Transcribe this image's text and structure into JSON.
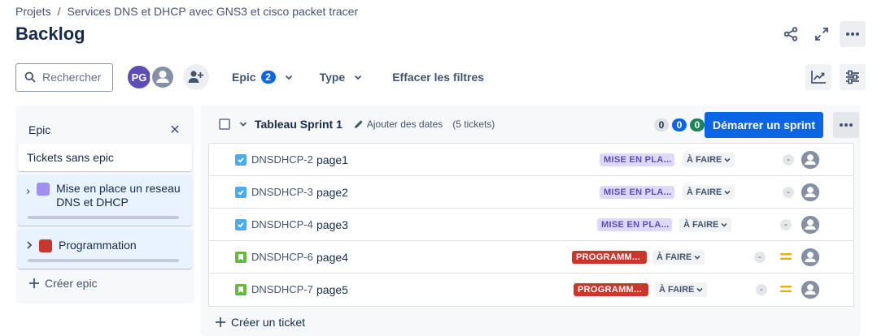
{
  "breadcrumb": {
    "root": "Projets",
    "separator": "/",
    "project": "Services DNS et DHCP avec GNS3 et cisco packet tracer"
  },
  "page": {
    "title": "Backlog"
  },
  "top_actions": [
    "share-icon",
    "expand-icon",
    "more-icon"
  ],
  "filters": {
    "search_placeholder": "Rechercher",
    "avatar_initials": "PG",
    "epic_label": "Epic",
    "epic_count": "2",
    "type_label": "Type",
    "clear_label": "Effacer les filtres"
  },
  "epic_panel": {
    "title": "Epic",
    "no_epic": "Tickets sans epic",
    "epics": [
      {
        "name": "Mise en place un reseau DNS et DHCP",
        "color": "#9f8fef"
      },
      {
        "name": "Programmation",
        "color": "#c9372c"
      }
    ],
    "create_label": "Créer epic"
  },
  "sprint": {
    "title": "Tableau Sprint 1",
    "add_dates": "Ajouter des dates",
    "ticket_count": "(5 tickets)",
    "count_todo": "0",
    "count_inprogress": "0",
    "count_done": "0",
    "start_label": "Démarrer un sprint",
    "tickets": [
      {
        "key": "DNSDHCP-2",
        "summary": "page1",
        "type": "task",
        "epic": "MISE EN PLA...",
        "status": "À FAIRE",
        "estimate": "-"
      },
      {
        "key": "DNSDHCP-3",
        "summary": "page2",
        "type": "task",
        "epic": "MISE EN PLA...",
        "status": "À FAIRE",
        "estimate": "-"
      },
      {
        "key": "DNSDHCP-4",
        "summary": "page3",
        "type": "task",
        "epic": "MISE EN PLA...",
        "status": "À FAIRE",
        "estimate": "-"
      },
      {
        "key": "DNSDHCP-6",
        "summary": "page4",
        "type": "story",
        "epic": "PROGRAMM...",
        "status": "À FAIRE",
        "estimate": "-",
        "priority": "medium"
      },
      {
        "key": "DNSDHCP-7",
        "summary": "page5",
        "type": "story",
        "epic": "PROGRAMM...",
        "status": "À FAIRE",
        "estimate": "-",
        "priority": "medium"
      }
    ],
    "create_ticket": "Créer un ticket"
  },
  "colors": {
    "brand_blue": "#0c66e4",
    "epic_purple_bg": "#dfd8fd",
    "epic_red_bg": "#c9372c",
    "priority_medium": "#e2b203"
  }
}
